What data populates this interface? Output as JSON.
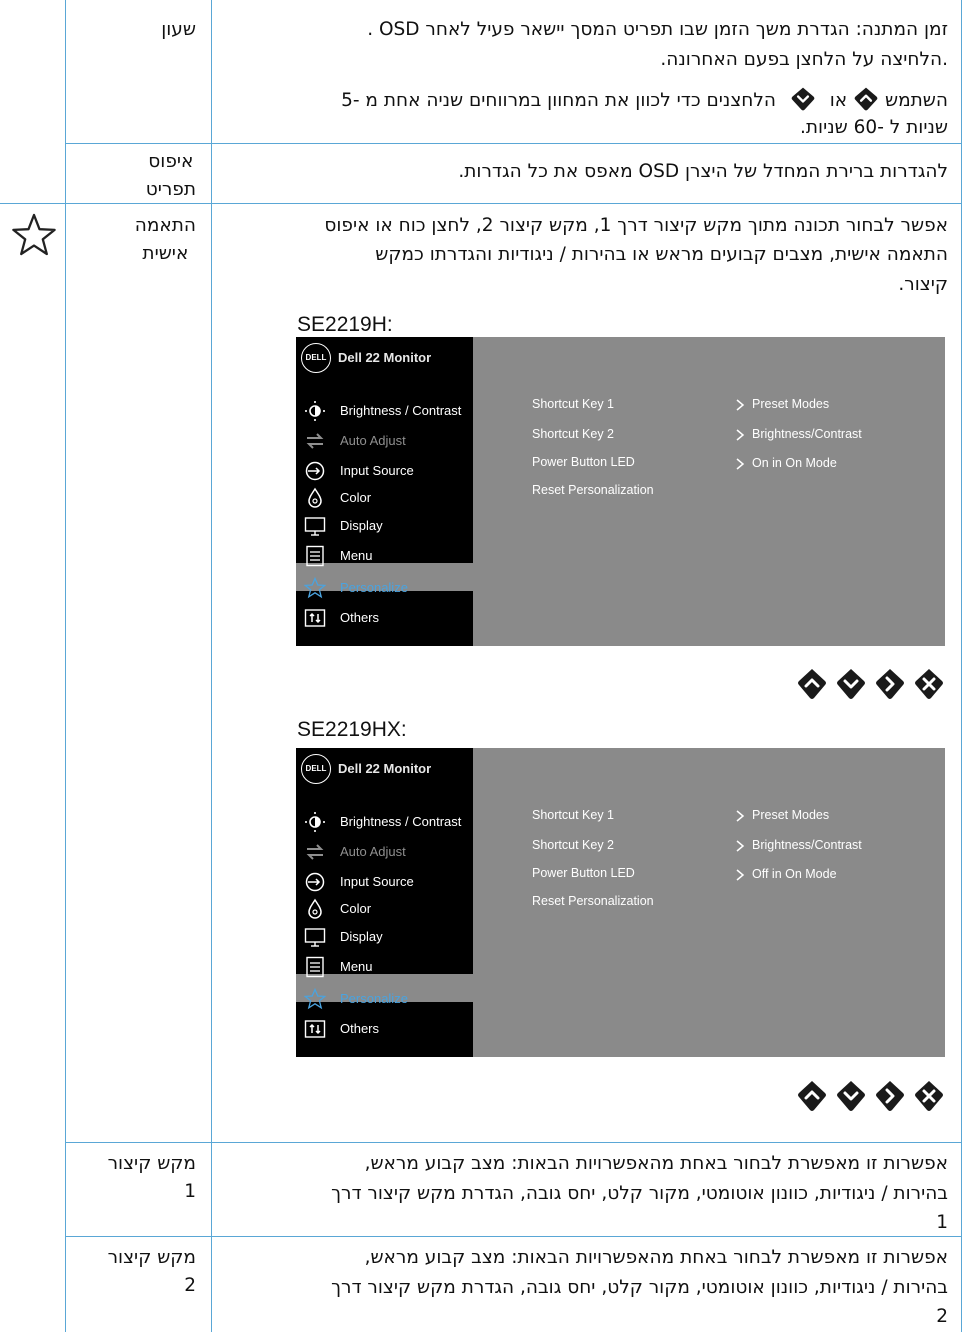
{
  "rows": [
    {
      "name": "שעון",
      "desc": [
        "זמן המתנה: הגדרת משך הזמן שבו תפריט המסך יישאר פעיל לאחר OSD .",
        ".הלחיצה על הלחצן בפעם האחרונה."
      ],
      "use_line": {
        "pre": "השתמש",
        "mid": "או",
        "post": "הלחצנים כדי לכוון את המחוון במרווחים שניה אחת מ -5"
      },
      "use_line2": "שניות ל -60 שניות."
    },
    {
      "name_lines": [
        "איפוס",
        "תפריט"
      ],
      "desc": "להגדרות ברירת המחדל של היצרן OSD מאפס את כל הגדרות."
    },
    {
      "name_lines": [
        "התאמה",
        "אישית"
      ],
      "desc_lines": [
        "אפשר לבחור תכונה מתוך מקש קיצור דרך 1, מקש קיצור 2, לחצן כוח או איפוס",
        "התאמה אישית, מצבים קבועים מראש או בהירות / ניגודיות והגדרתו כמקש",
        "קיצור."
      ],
      "icon": "star-icon"
    },
    {
      "name_lines": [
        "מקש קיצור",
        "1"
      ],
      "desc_lines": [
        "אפשרות זו מאפשרת לבחור באחת מהאפשרויות הבאות: מצב קבוע מראש,",
        "בהירות / ניגודיות, כוונון אוטומטי, מקור קלט, יחס גובה, הגדרת מקש קיצור דרך",
        "1"
      ]
    },
    {
      "name_lines": [
        "מקש קיצור",
        "2"
      ],
      "desc_lines": [
        "אפשרות זו מאפשרת לבחור באחת מהאפשרויות הבאות: מצב קבוע מראש,",
        "בהירות / ניגודיות, כוונון אוטומטי, מקור קלט, יחס גובה, הגדרת מקש קיצור דרך",
        "2"
      ]
    }
  ],
  "osd_screens": [
    {
      "model": "SE2219H:",
      "logo": "DELL",
      "title": "Dell 22 Monitor",
      "menu": [
        "Brightness / Contrast",
        "Auto Adjust",
        "Input Source",
        "Color",
        "Display",
        "Menu",
        "Personalize",
        "Others"
      ],
      "left_items": [
        "Shortcut Key 1",
        "Shortcut Key 2",
        "Power Button LED",
        "Reset Personalization"
      ],
      "right_items": [
        "Preset Modes",
        "Brightness/Contrast",
        "On in On Mode"
      ]
    },
    {
      "model": "SE2219HX:",
      "logo": "DELL",
      "title": "Dell 22 Monitor",
      "menu": [
        "Brightness / Contrast",
        "Auto Adjust",
        "Input Source",
        "Color",
        "Display",
        "Menu",
        "Personalize",
        "Others"
      ],
      "left_items": [
        "Shortcut Key 1",
        "Shortcut Key 2",
        "Power Button LED",
        "Reset Personalization"
      ],
      "right_items": [
        "Preset Modes",
        "Brightness/Contrast",
        "Off in On Mode"
      ]
    }
  ],
  "nav_buttons": [
    "up-button-icon",
    "down-button-icon",
    "next-button-icon",
    "exit-button-icon"
  ],
  "colors": {
    "rule": "#5aa7d6",
    "osd_bg": "#8a8a8a",
    "osd_side": "#000000",
    "highlight": "#4aa3df"
  }
}
